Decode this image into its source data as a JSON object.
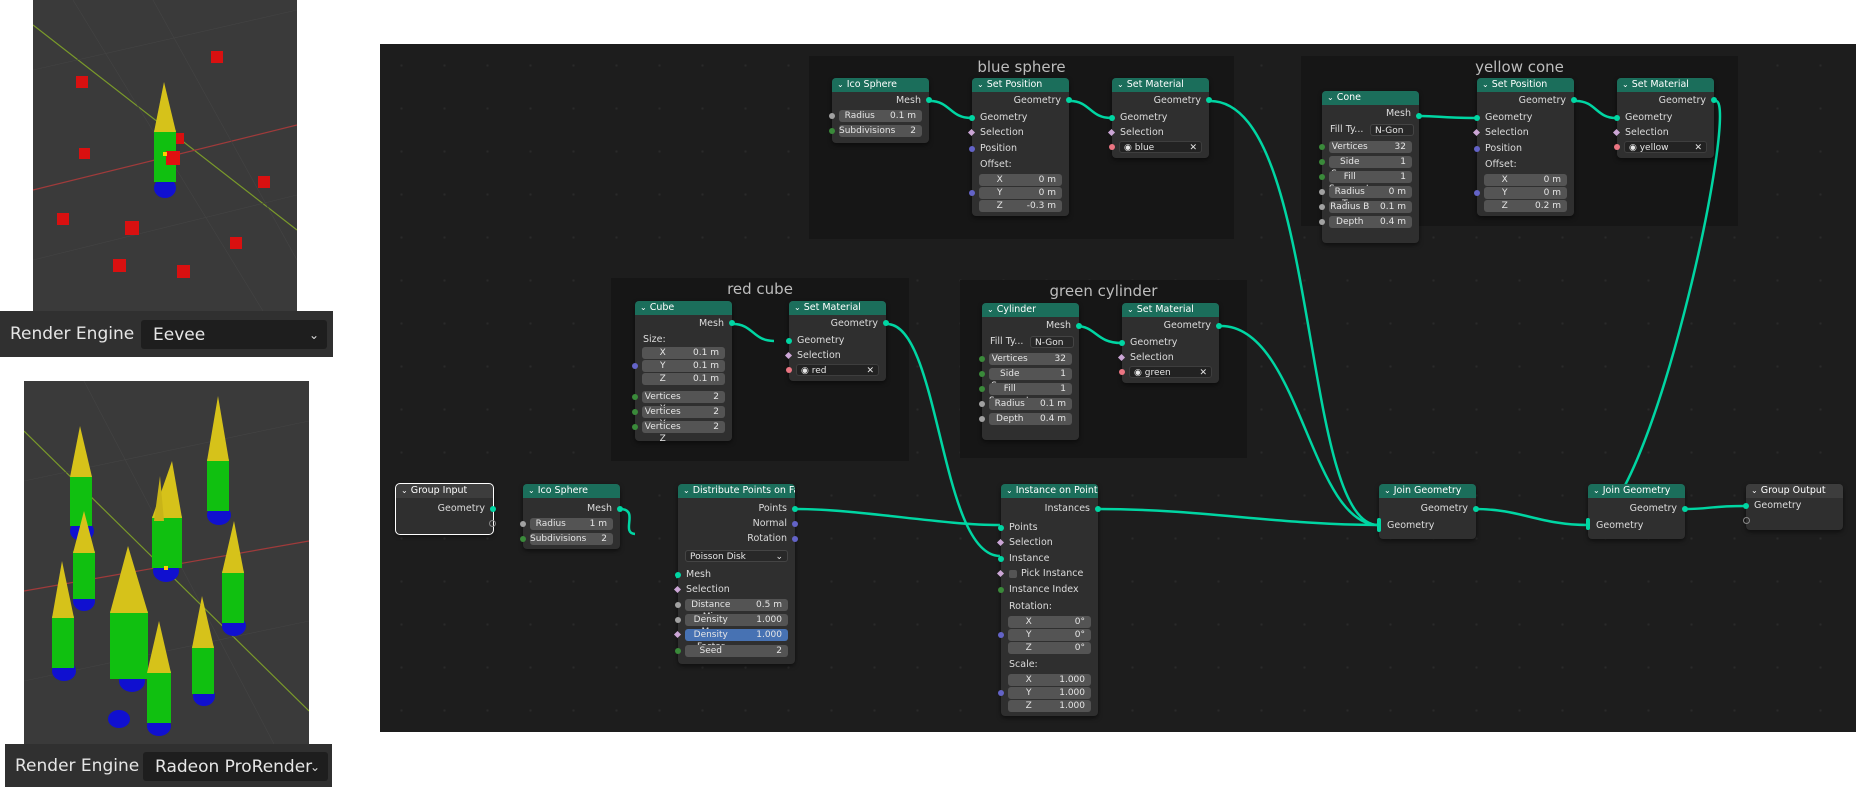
{
  "views": [
    {
      "engine_label": "Render Engine",
      "engine_value": "Eevee"
    },
    {
      "engine_label": "Render Engine",
      "engine_value": "Radeon ProRender"
    }
  ],
  "frames": {
    "blue_sphere": "blue sphere",
    "yellow_cone": "yellow cone",
    "red_cube": "red cube",
    "green_cylinder": "green cylinder"
  },
  "common": {
    "geometry": "Geometry",
    "selection": "Selection",
    "position": "Position",
    "offset": "Offset:",
    "mesh": "Mesh",
    "x": "X",
    "y": "Y",
    "z": "Z",
    "fill_type": "Fill Ty...",
    "ngon": "N-Gon"
  },
  "nodes": {
    "bs_ico": {
      "title": "Ico Sphere",
      "radius_label": "Radius",
      "radius": "0.1 m",
      "subdiv_label": "Subdivisions",
      "subdiv": "2"
    },
    "bs_setpos": {
      "title": "Set Position",
      "x": "0 m",
      "y": "0 m",
      "z": "-0.3 m"
    },
    "bs_setmat": {
      "title": "Set Material",
      "material": "blue"
    },
    "yc_cone": {
      "title": "Cone",
      "vertices_label": "Vertices",
      "vertices": "32",
      "side_label": "Side Segmen",
      "side": "1",
      "fill_label": "Fill Segments",
      "fill": "1",
      "rtop_label": "Radius Top",
      "rtop": "0 m",
      "rbot_label": "Radius B",
      "rbot": "0.1 m",
      "depth_label": "Depth",
      "depth": "0.4 m"
    },
    "yc_setpos": {
      "title": "Set Position",
      "x": "0 m",
      "y": "0 m",
      "z": "0.2 m"
    },
    "yc_setmat": {
      "title": "Set Material",
      "material": "yellow"
    },
    "rc_cube": {
      "title": "Cube",
      "size_label": "Size:",
      "x": "0.1 m",
      "y": "0.1 m",
      "z": "0.1 m",
      "vx_label": "Vertices X",
      "vx": "2",
      "vy_label": "Vertices Y",
      "vy": "2",
      "vz_label": "Vertices Z",
      "vz": "2"
    },
    "rc_setmat": {
      "title": "Set Material",
      "material": "red"
    },
    "gc_cyl": {
      "title": "Cylinder",
      "vertices_label": "Vertices",
      "vertices": "32",
      "side_label": "Side Segmen",
      "side": "1",
      "fill_label": "Fill Segments",
      "fill": "1",
      "radius_label": "Radius",
      "radius": "0.1 m",
      "depth_label": "Depth",
      "depth": "0.4 m"
    },
    "gc_setmat": {
      "title": "Set Material",
      "material": "green"
    },
    "group_input": {
      "title": "Group Input",
      "geometry": "Geometry"
    },
    "ico_main": {
      "title": "Ico Sphere",
      "radius_label": "Radius",
      "radius": "1 m",
      "subdiv_label": "Subdivisions",
      "subdiv": "2"
    },
    "distribute": {
      "title": "Distribute Points on Face",
      "points": "Points",
      "normal": "Normal",
      "rotation": "Rotation",
      "mode": "Poisson Disk",
      "mesh": "Mesh",
      "selection": "Selection",
      "dmin_label": "Distance Min",
      "dmin": "0.5 m",
      "dmax_label": "Density Max",
      "dmax": "1.000",
      "dfac_label": "Density Factor",
      "dfac": "1.000",
      "seed_label": "Seed",
      "seed": "2"
    },
    "instance": {
      "title": "Instance on Points",
      "instances": "Instances",
      "points": "Points",
      "selection": "Selection",
      "instance": "Instance",
      "pick": "Pick Instance",
      "index": "Instance Index",
      "rotation": "Rotation:",
      "rx": "0°",
      "ry": "0°",
      "rz": "0°",
      "scale": "Scale:",
      "sx": "1.000",
      "sy": "1.000",
      "sz": "1.000"
    },
    "join1": {
      "title": "Join Geometry",
      "geometry": "Geometry"
    },
    "join2": {
      "title": "Join Geometry",
      "geometry": "Geometry"
    },
    "group_output": {
      "title": "Group Output",
      "geometry": "Geometry"
    }
  }
}
